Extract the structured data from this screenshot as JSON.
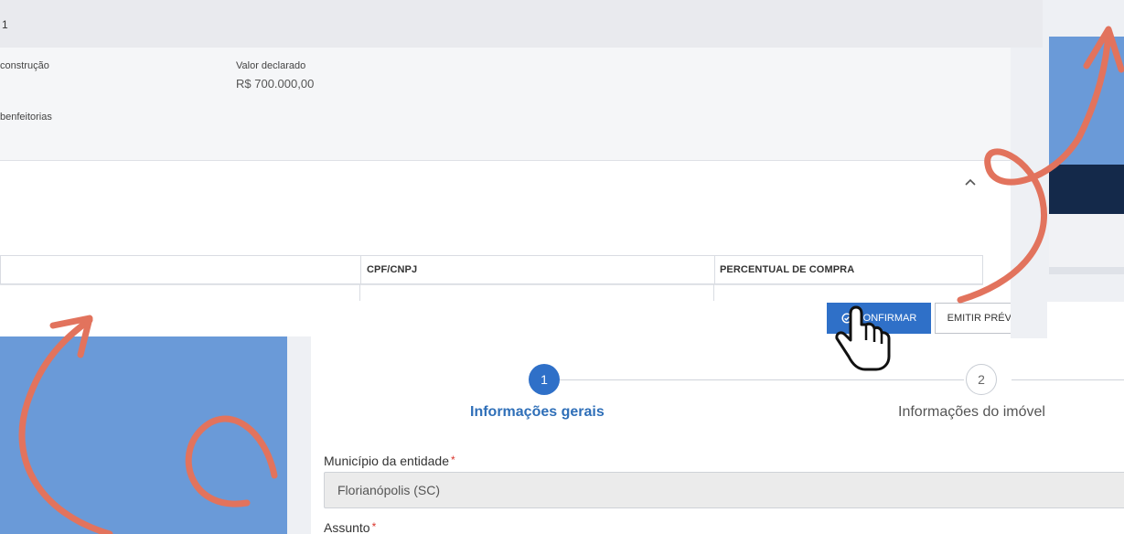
{
  "top": {
    "entry_number": "1",
    "info": {
      "construcao_label": "construção",
      "valor_label": "Valor declarado",
      "valor_value": "R$ 700.000,00",
      "benfeitorias_label": "benfeitorias"
    },
    "table": {
      "columns": [
        "CPF/CNPJ",
        "PERCENTUAL DE COMPRA"
      ]
    },
    "buttons": {
      "confirm_label": "CONFIRMAR",
      "preview_label": "EMITIR PRÉVIA"
    }
  },
  "stepper": {
    "steps": [
      {
        "number": "1",
        "label": "Informações gerais"
      },
      {
        "number": "2",
        "label": "Informações do imóvel"
      }
    ]
  },
  "form": {
    "municipio_label": "Município da entidade",
    "municipio_value": "Florianópolis (SC)",
    "assunto_label": "Assunto"
  },
  "colors": {
    "primary": "#2f70c8",
    "accent_arrow": "#e2735d",
    "deco_blue": "#6a9ad8",
    "deco_navy": "#14294a"
  },
  "icons": [
    "check-circle-icon",
    "chevron-up-icon",
    "pointer-hand-icon"
  ]
}
